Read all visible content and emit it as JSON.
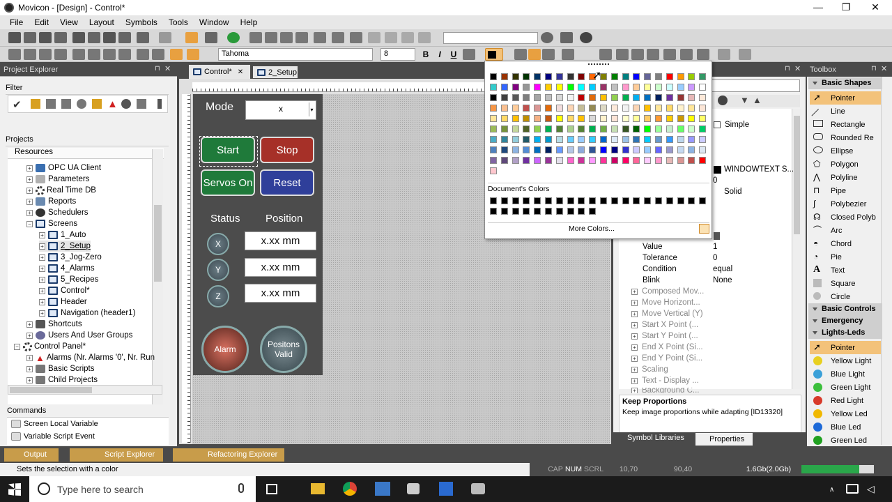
{
  "window": {
    "title": "Movicon - [Design] - Control*",
    "minimize": "—",
    "maximize": "❐",
    "close": "✕"
  },
  "menu": [
    "File",
    "Edit",
    "View",
    "Layout",
    "Symbols",
    "Tools",
    "Window",
    "Help"
  ],
  "format_toolbar": {
    "font": "Tahoma",
    "size": "8"
  },
  "project_explorer": {
    "title": "Project Explorer",
    "filter_label": "Filter",
    "projects_label": "Projects",
    "resources_label": "Resources",
    "tree": [
      {
        "label": "OPC UA Client",
        "exp": "+"
      },
      {
        "label": "Parameters",
        "exp": "+"
      },
      {
        "label": "Real Time DB",
        "exp": "+"
      },
      {
        "label": "Reports",
        "exp": "+"
      },
      {
        "label": "Schedulers",
        "exp": "+"
      },
      {
        "label": "Screens",
        "exp": "−"
      },
      {
        "label": "1_Auto",
        "exp": "+"
      },
      {
        "label": "2_Setup",
        "exp": "+"
      },
      {
        "label": "3_Jog-Zero",
        "exp": "+"
      },
      {
        "label": "4_Alarms",
        "exp": "+"
      },
      {
        "label": "5_Recipes",
        "exp": "+"
      },
      {
        "label": "Control*",
        "exp": "+"
      },
      {
        "label": "Header",
        "exp": "+"
      },
      {
        "label": "Navigation (header1)",
        "exp": "+"
      },
      {
        "label": "Shortcuts",
        "exp": "+"
      },
      {
        "label": "Users And User Groups",
        "exp": "+"
      },
      {
        "label": "Control Panel*",
        "exp": "−"
      },
      {
        "label": "Alarms (Nr. Alarms '0', Nr. Run",
        "exp": "+"
      },
      {
        "label": "Basic Scripts",
        "exp": "+"
      },
      {
        "label": "Child Projects",
        "exp": "+"
      }
    ],
    "commands_label": "Commands",
    "commands": [
      "Screen Local Variable",
      "Variable Script Event"
    ]
  },
  "doc_tabs": [
    {
      "label": "Control*",
      "close": "✕"
    },
    {
      "label": "2_Setup"
    }
  ],
  "hmi": {
    "mode_label": "Mode",
    "mode_value": "x",
    "buttons": [
      {
        "label": "Start",
        "color": "#1f7a3a"
      },
      {
        "label": "Stop",
        "color": "#a63028"
      },
      {
        "label": "Servos On",
        "color": "#1f7a3a"
      },
      {
        "label": "Reset",
        "color": "#2f3f9a"
      }
    ],
    "status_label": "Status",
    "position_label": "Position",
    "axes": [
      {
        "name": "X",
        "value": "x.xx mm"
      },
      {
        "name": "Y",
        "value": "x.xx mm"
      },
      {
        "name": "Z",
        "value": "x.xx mm"
      }
    ],
    "lamps": [
      {
        "label": "Alarm"
      },
      {
        "label": "Positons Valid"
      }
    ]
  },
  "color_popup": {
    "documents_colors_label": "Document's Colors",
    "more_colors_label": "More Colors...",
    "palette": [
      [
        "#000000",
        "#993300",
        "#333300",
        "#003300",
        "#003366",
        "#000080",
        "#333399",
        "#333333",
        "#800000",
        "#ff6600",
        "#808000",
        "#008000",
        "#008080",
        "#0000ff",
        "#666699",
        "#808080",
        "#ff0000",
        "#ff9900",
        "#99cc00",
        "#339966"
      ],
      [
        "#33cccc",
        "#3366ff",
        "#800080",
        "#969696",
        "#ff00ff",
        "#ffcc00",
        "#ffff00",
        "#00ff00",
        "#00ffff",
        "#00ccff",
        "#993366",
        "#c0c0c0",
        "#ff99cc",
        "#ffcc99",
        "#ffff99",
        "#ccffcc",
        "#ccffff",
        "#99ccff",
        "#cc99ff",
        "#ffffff"
      ],
      [
        "#000000",
        "#404040",
        "#595959",
        "#7f7f7f",
        "#a5a5a5",
        "#bfbfbf",
        "#d8d8d8",
        "#f2f2f2",
        "#c00000",
        "#e26b0a",
        "#ffc000",
        "#92d050",
        "#00b050",
        "#00b0f0",
        "#0070c0",
        "#002060",
        "#7030a0",
        "#963634",
        "#e6b8b7",
        "#fde9d9"
      ],
      [
        "#f79646",
        "#fabf8f",
        "#ffcc99",
        "#c0504d",
        "#da9694",
        "#e26b0a",
        "#f2dcdb",
        "#fcd5b4",
        "#c4bd97",
        "#948a54",
        "#ddd9c4",
        "#fde9d9",
        "#f2f2f2",
        "#fcd5b4",
        "#ffc000",
        "#ffe699",
        "#ffd966",
        "#fff2cc",
        "#ffe699",
        "#fbe5d6"
      ],
      [
        "#ffe699",
        "#ffd966",
        "#ffc000",
        "#bf8f00",
        "#f4b084",
        "#c65911",
        "#ffff00",
        "#ffd966",
        "#ffc000",
        "#d9d9d9",
        "#fff2cc",
        "#fce4d6",
        "#ffffcc",
        "#ffff99",
        "#ffcc66",
        "#ff9933",
        "#ffcc00",
        "#cc9900",
        "#ffff00",
        "#ffff66"
      ],
      [
        "#9bbb59",
        "#76933c",
        "#c4d79b",
        "#4f6228",
        "#92d050",
        "#00b050",
        "#538135",
        "#a9d08e",
        "#548235",
        "#00b050",
        "#70ad47",
        "#c6e0b4",
        "#375623",
        "#006100",
        "#00ff00",
        "#99ff99",
        "#c6efce",
        "#66ff66",
        "#ccffcc",
        "#00cc66"
      ],
      [
        "#4bacc6",
        "#31859c",
        "#92cddc",
        "#215967",
        "#00b0f0",
        "#0099cc",
        "#b7dee8",
        "#66ccff",
        "#99ccff",
        "#33ccff",
        "#0066cc",
        "#ddebf7",
        "#9bc2e6",
        "#2f75b5",
        "#00ccff",
        "#6699cc",
        "#3399ff",
        "#bdd7ee",
        "#9999ff",
        "#ccccff"
      ],
      [
        "#4f81bd",
        "#1f497d",
        "#8db4e2",
        "#548dd4",
        "#0070c0",
        "#002060",
        "#6699ff",
        "#b4c6e7",
        "#8ea9db",
        "#305496",
        "#0000ff",
        "#000080",
        "#3333cc",
        "#cccaff",
        "#99ccff",
        "#6666ff",
        "#9999cc",
        "#c5d9f1",
        "#8db3e2",
        "#dce6f1"
      ],
      [
        "#8064a2",
        "#5f497a",
        "#b1a0c7",
        "#7030a0",
        "#cc66ff",
        "#993399",
        "#e4dfec",
        "#ff66cc",
        "#cc3399",
        "#ff99ff",
        "#ff3399",
        "#cc0066",
        "#ff0066",
        "#ff6699",
        "#ffccff",
        "#ff99cc",
        "#e6b8b7",
        "#da9694",
        "#c0504d",
        "#ff0000"
      ],
      [
        "#ffc7ce"
      ]
    ],
    "doc_colors_row1": 20,
    "doc_colors_row2": 10
  },
  "properties": {
    "rows": [
      {
        "k": "",
        "v": "Simple",
        "checkbox": true
      },
      {
        "k": "",
        "v": "WINDOWTEXT S...",
        "swatch": true
      },
      {
        "k": "",
        "v": "0"
      },
      {
        "k": "",
        "v": "Solid"
      },
      {
        "k": "Value",
        "v": "1"
      },
      {
        "k": "Tolerance",
        "v": "0"
      },
      {
        "k": "Condition",
        "v": "equal"
      },
      {
        "k": "Blink",
        "v": "None"
      }
    ],
    "groups": [
      "Composed Mov...",
      "Move Horizont...",
      "Move Vertical (Y)",
      "Start X Point (...",
      "Start Y Point (...",
      "End X Point (Si...",
      "End Y Point (Si...",
      "Scaling",
      "Text - Display ...",
      "Background C..."
    ],
    "help_title": "Keep Proportions",
    "help_text": "Keep image proportions while adapting [ID13320]",
    "tabs": [
      "Symbol Libraries",
      "Properties"
    ]
  },
  "toolbox": {
    "title": "Toolbox",
    "basic_shapes_label": "Basic Shapes",
    "basic_shapes": [
      "Pointer",
      "Line",
      "Rectangle",
      "Rounded Re",
      "Ellipse",
      "Polygon",
      "Polyline",
      "Pipe",
      "Polybezier",
      "Closed Polyb",
      "Arc",
      "Chord",
      "Pie",
      "Text",
      "Square",
      "Circle"
    ],
    "basic_controls_label": "Basic Controls",
    "emergency_label": "Emergency But...",
    "lights_label": "Lights-Leds",
    "lights": [
      {
        "label": "Pointer",
        "color": ""
      },
      {
        "label": "Yellow Light",
        "color": "#e8d020"
      },
      {
        "label": "Blue Light",
        "color": "#3aa0d8"
      },
      {
        "label": "Green Light",
        "color": "#3cbf3c"
      },
      {
        "label": "Red Light",
        "color": "#d83a2a"
      },
      {
        "label": "Yellow Led",
        "color": "#f0b800"
      },
      {
        "label": "Blue Led",
        "color": "#1e6ad8"
      },
      {
        "label": "Green Led",
        "color": "#20a020"
      }
    ]
  },
  "bottom_tabs": [
    "Output",
    "Script Explorer",
    "Refactoring Explorer"
  ],
  "status": {
    "message": "Sets the selection with a color",
    "cap": "CAP",
    "num": "NUM",
    "scrl": "SCRL",
    "pos": "10,70",
    "size": "90,40",
    "mem": "1.6Gb(2.0Gb)"
  },
  "taskbar": {
    "search_placeholder": "Type here to search"
  }
}
